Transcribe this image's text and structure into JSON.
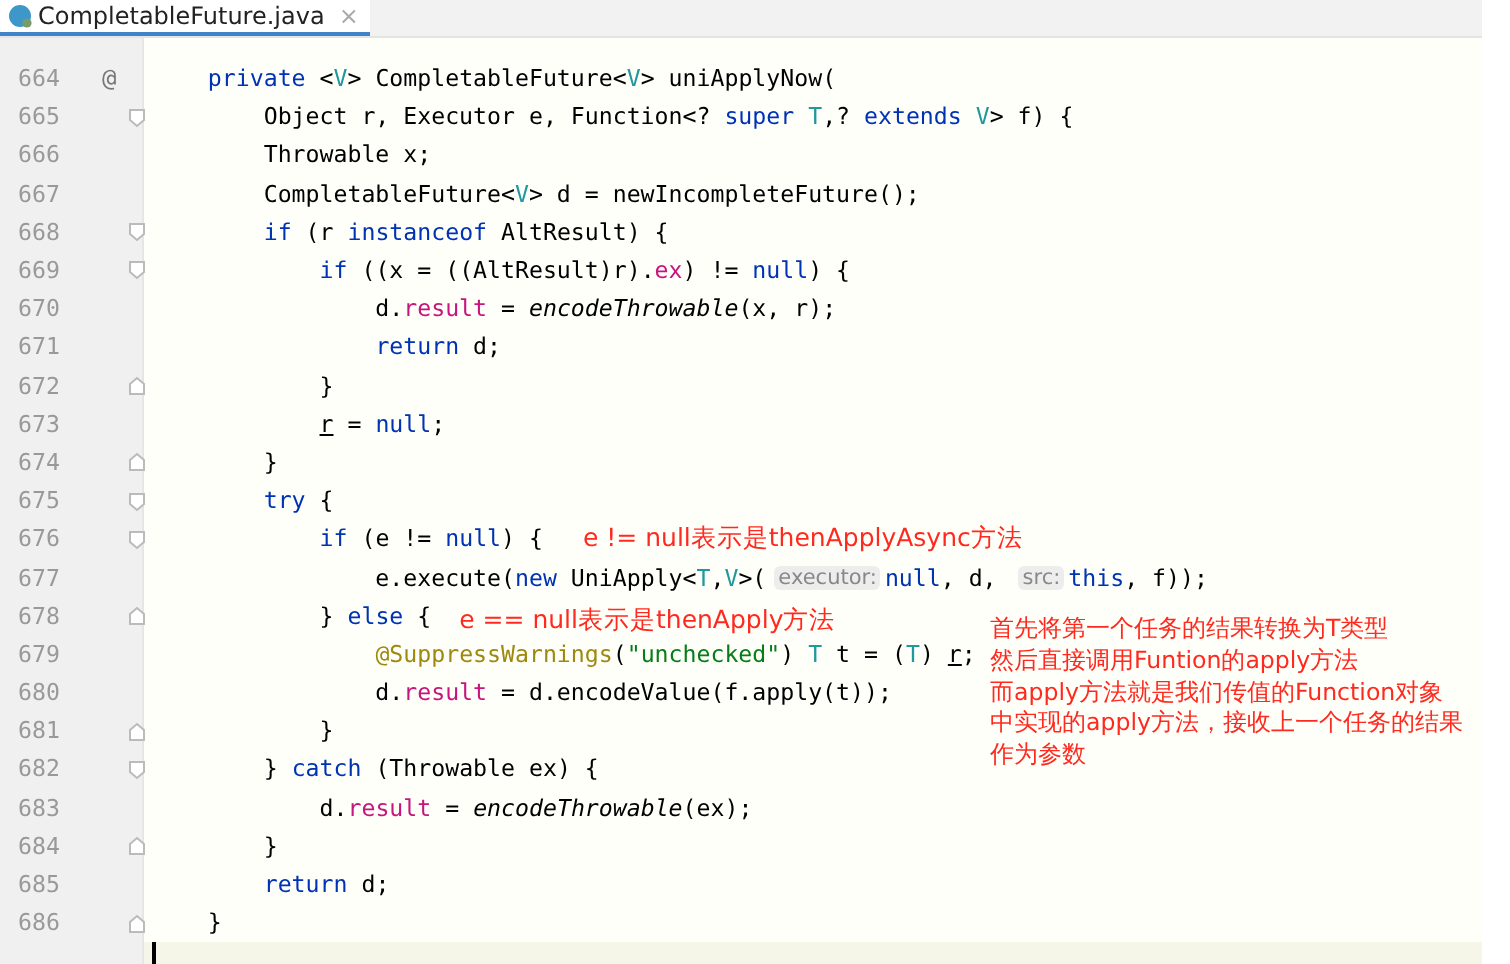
{
  "tab": {
    "label": "CompletableFuture.java",
    "close": "×",
    "selected": true
  },
  "lines": [
    {
      "number": "664",
      "marker": "@",
      "fold_start": false,
      "fold_end": false,
      "tokens": [
        {
          "kind": "kw",
          "text": "    private "
        },
        {
          "kind": "plain",
          "text": "<"
        },
        {
          "kind": "tp",
          "text": "V"
        },
        {
          "kind": "plain",
          "text": "> CompletableFuture<"
        },
        {
          "kind": "tp",
          "text": "V"
        },
        {
          "kind": "plain",
          "text": "> uniApplyNow("
        }
      ]
    },
    {
      "number": "665",
      "fold_start": true,
      "fold_end": false,
      "tokens": [
        {
          "kind": "plain",
          "text": "        Object r, Executor e, Function<? "
        },
        {
          "kind": "kw",
          "text": "super "
        },
        {
          "kind": "tp",
          "text": "T"
        },
        {
          "kind": "plain",
          "text": ",? "
        },
        {
          "kind": "kw",
          "text": "extends "
        },
        {
          "kind": "tp",
          "text": "V"
        },
        {
          "kind": "plain",
          "text": "> f) {"
        }
      ]
    },
    {
      "number": "666",
      "fold_start": false,
      "fold_end": false,
      "tokens": [
        {
          "kind": "plain",
          "text": "        Throwable x;"
        }
      ]
    },
    {
      "number": "667",
      "fold_start": false,
      "fold_end": false,
      "tokens": [
        {
          "kind": "plain",
          "text": "        CompletableFuture<"
        },
        {
          "kind": "tp",
          "text": "V"
        },
        {
          "kind": "plain",
          "text": "> d = newIncompleteFuture();"
        }
      ]
    },
    {
      "number": "668",
      "fold_start": true,
      "fold_end": false,
      "tokens": [
        {
          "kind": "kw",
          "text": "        if"
        },
        {
          "kind": "plain",
          "text": " (r "
        },
        {
          "kind": "kw",
          "text": "instanceof"
        },
        {
          "kind": "plain",
          "text": " AltResult) {"
        }
      ]
    },
    {
      "number": "669",
      "fold_start": true,
      "fold_end": false,
      "tokens": [
        {
          "kind": "kw",
          "text": "            if"
        },
        {
          "kind": "plain",
          "text": " ((x = ((AltResult)r)."
        },
        {
          "kind": "field",
          "text": "ex"
        },
        {
          "kind": "plain",
          "text": ") != "
        },
        {
          "kind": "kw",
          "text": "null"
        },
        {
          "kind": "plain",
          "text": ") {"
        }
      ]
    },
    {
      "number": "670",
      "fold_start": false,
      "fold_end": false,
      "tokens": [
        {
          "kind": "plain",
          "text": "                d."
        },
        {
          "kind": "field",
          "text": "result"
        },
        {
          "kind": "plain",
          "text": " = "
        },
        {
          "kind": "italic",
          "text": "encodeThrowable"
        },
        {
          "kind": "plain",
          "text": "(x, r);"
        }
      ]
    },
    {
      "number": "671",
      "fold_start": false,
      "fold_end": false,
      "tokens": [
        {
          "kind": "kw",
          "text": "                return"
        },
        {
          "kind": "plain",
          "text": " d;"
        }
      ]
    },
    {
      "number": "672",
      "fold_start": false,
      "fold_end": true,
      "tokens": [
        {
          "kind": "plain",
          "text": "            }"
        }
      ]
    },
    {
      "number": "673",
      "fold_start": false,
      "fold_end": false,
      "tokens": [
        {
          "kind": "reassigned",
          "text": "            r"
        },
        {
          "kind": "plain",
          "text": " = "
        },
        {
          "kind": "kw",
          "text": "null"
        },
        {
          "kind": "plain",
          "text": ";"
        }
      ]
    },
    {
      "number": "674",
      "fold_start": false,
      "fold_end": true,
      "tokens": [
        {
          "kind": "plain",
          "text": "        }"
        }
      ]
    },
    {
      "number": "675",
      "fold_start": true,
      "fold_end": false,
      "tokens": [
        {
          "kind": "kw",
          "text": "        try"
        },
        {
          "kind": "plain",
          "text": " {"
        }
      ]
    },
    {
      "number": "676",
      "fold_start": true,
      "fold_end": false,
      "tokens": [
        {
          "kind": "kw",
          "text": "            if"
        },
        {
          "kind": "plain",
          "text": " (e != "
        },
        {
          "kind": "kw",
          "text": "null"
        },
        {
          "kind": "plain",
          "text": ") {"
        }
      ],
      "note": "e != null表示是thenApplyAsync方法"
    },
    {
      "number": "677",
      "fold_start": false,
      "fold_end": false,
      "tokens": [
        {
          "kind": "plain",
          "text": "                e.execute("
        },
        {
          "kind": "kw",
          "text": "new"
        },
        {
          "kind": "plain",
          "text": " UniApply<"
        },
        {
          "kind": "tp",
          "text": "T"
        },
        {
          "kind": "plain",
          "text": ","
        },
        {
          "kind": "tp",
          "text": "V"
        },
        {
          "kind": "plain",
          "text": ">("
        },
        {
          "kind": "hint",
          "text": "executor:"
        },
        {
          "kind": "kw",
          "text": "null"
        },
        {
          "kind": "plain",
          "text": ", d, "
        },
        {
          "kind": "hint",
          "text": "src:"
        },
        {
          "kind": "kw",
          "text": "this"
        },
        {
          "kind": "plain",
          "text": ", f));"
        }
      ]
    },
    {
      "number": "678",
      "fold_start": false,
      "fold_end": true,
      "tokens": [
        {
          "kind": "plain",
          "text": "            } "
        },
        {
          "kind": "kw",
          "text": "else"
        },
        {
          "kind": "plain",
          "text": " {"
        }
      ],
      "note": "e == null表示是thenApply方法",
      "side_note": [
        "首先将第一个任务的结果转换为T类型",
        "然后直接调用Funtion的apply方法",
        "而apply方法就是我们传值的Function对象",
        "中实现的apply方法，接收上一个任务的结果",
        "作为参数"
      ]
    },
    {
      "number": "679",
      "fold_start": false,
      "fold_end": false,
      "tokens": [
        {
          "kind": "annotation",
          "text": "                @SuppressWarnings"
        },
        {
          "kind": "plain",
          "text": "("
        },
        {
          "kind": "string",
          "text": "\"unchecked\""
        },
        {
          "kind": "plain",
          "text": ") "
        },
        {
          "kind": "tp",
          "text": "T"
        },
        {
          "kind": "plain",
          "text": " t = ("
        },
        {
          "kind": "tp",
          "text": "T"
        },
        {
          "kind": "plain",
          "text": ") "
        },
        {
          "kind": "reassigned",
          "text": "r"
        },
        {
          "kind": "plain",
          "text": ";"
        }
      ]
    },
    {
      "number": "680",
      "fold_start": false,
      "fold_end": false,
      "tokens": [
        {
          "kind": "plain",
          "text": "                d."
        },
        {
          "kind": "field",
          "text": "result"
        },
        {
          "kind": "plain",
          "text": " = d.encodeValue(f.apply(t));"
        }
      ]
    },
    {
      "number": "681",
      "fold_start": false,
      "fold_end": true,
      "tokens": [
        {
          "kind": "plain",
          "text": "            }"
        }
      ]
    },
    {
      "number": "682",
      "fold_start": true,
      "fold_end": false,
      "tokens": [
        {
          "kind": "plain",
          "text": "        } "
        },
        {
          "kind": "kw",
          "text": "catch"
        },
        {
          "kind": "plain",
          "text": " (Throwable ex) {"
        }
      ]
    },
    {
      "number": "683",
      "fold_start": false,
      "fold_end": false,
      "tokens": [
        {
          "kind": "plain",
          "text": "            d."
        },
        {
          "kind": "field",
          "text": "result"
        },
        {
          "kind": "plain",
          "text": " = "
        },
        {
          "kind": "italic",
          "text": "encodeThrowable"
        },
        {
          "kind": "plain",
          "text": "(ex);"
        }
      ]
    },
    {
      "number": "684",
      "fold_start": false,
      "fold_end": true,
      "tokens": [
        {
          "kind": "plain",
          "text": "        }"
        }
      ]
    },
    {
      "number": "685",
      "fold_start": false,
      "fold_end": false,
      "tokens": [
        {
          "kind": "kw",
          "text": "        return"
        },
        {
          "kind": "plain",
          "text": " d;"
        }
      ]
    },
    {
      "number": "686",
      "fold_start": false,
      "fold_end": true,
      "tokens": [
        {
          "kind": "plain",
          "text": "    }"
        }
      ]
    }
  ]
}
